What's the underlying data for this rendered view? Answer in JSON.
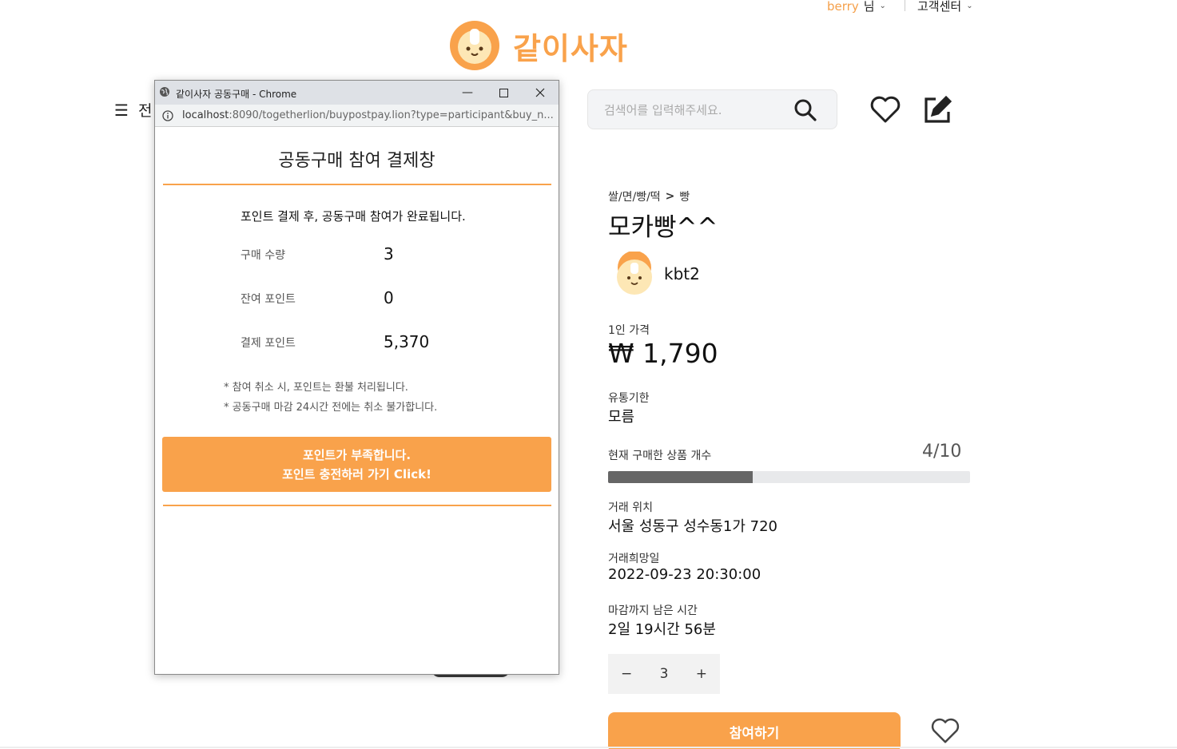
{
  "header": {
    "user_name": "berry",
    "user_suffix": "님",
    "customer_center": "고객센터",
    "logo_text": "같이사자",
    "menu_text": "전",
    "search_placeholder": "검색어를 입력해주세요."
  },
  "product": {
    "category_main": "쌀/면/빵/떡",
    "category_arrow": ">",
    "category_sub": "빵",
    "title": "모카빵^^",
    "seller": "kbt2",
    "price_label": "1인 가격",
    "price": "₩ 1,790",
    "expiry_label": "유통기한",
    "expiry": "모름",
    "count_label": "현재 구매한 상품 개수",
    "count": "4/10",
    "progress": 0.4,
    "location_label": "거래 위치",
    "location": "서울 성동구 성수동1가 720",
    "date_label": "거래희망일",
    "date": "2022-09-23 20:30:00",
    "remaining_label": "마감까지 남은 시간",
    "remaining": "2일 19시간 56분",
    "quantity": "3",
    "minus": "−",
    "plus": "+",
    "join_label": "참여하기"
  },
  "popup": {
    "window_title": "같이사자 공동구매 - Chrome",
    "url_host": "localhost",
    "url_rest": ":8090/togetherlion/buypostpay.lion?type=participant&buy_n...",
    "heading": "공동구매 참여 결제창",
    "notice": "포인트 결제 후, 공동구매 참여가 완료됩니다.",
    "rows": [
      {
        "label": "구매 수량",
        "value": "3"
      },
      {
        "label": "잔여 포인트",
        "value": "0"
      },
      {
        "label": "결제 포인트",
        "value": "5,370"
      }
    ],
    "note1": "* 참여 취소 시, 포인트는 환불 처리됩니다.",
    "note2": "* 공동구매 마감 24시간 전에는 취소 불가합니다.",
    "btn_line1": "포인트가 부족합니다.",
    "btn_line2": "포인트 충전하러 가기 Click!"
  },
  "colors": {
    "accent": "#f9a24b",
    "progress_fill": "#666666",
    "progress_track": "#e8e9eb"
  },
  "icons": [
    "lion-logo-icon",
    "search-icon",
    "heart-icon",
    "edit-icon",
    "menu-icon",
    "globe-icon",
    "info-icon",
    "minimize-icon",
    "maximize-icon",
    "close-icon",
    "chevron-down-icon"
  ]
}
